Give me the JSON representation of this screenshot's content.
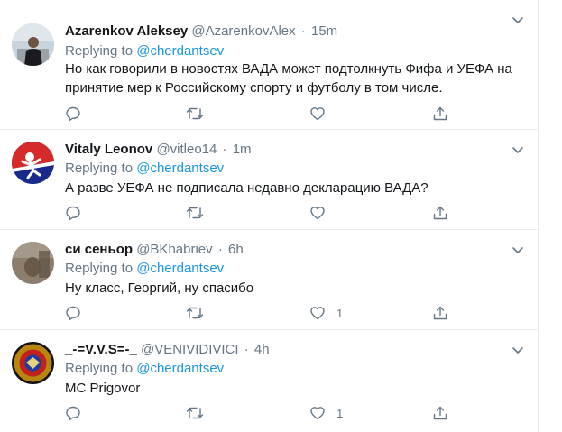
{
  "tweets": [
    {
      "name": "Azarenkov Aleksey",
      "handle": "@AzarenkovAlex",
      "separator": "·",
      "time": "15m",
      "replying_prefix": "Replying to ",
      "replying_to": "@cherdantsev",
      "text_lines": [
        "Но как говорили в новостях ВАДА может подтолкнуть Фифа и УЕФА на",
        "принятие мер к Российскому спорту и футболу в том числе."
      ],
      "like_count": ""
    },
    {
      "name": "Vitaly Leonov",
      "handle": "@vitleo14",
      "separator": "·",
      "time": "1m",
      "replying_prefix": "Replying to ",
      "replying_to": "@cherdantsev",
      "text_lines": [
        "А разве УЕФА не подписала недавно декларацию ВАДА?"
      ],
      "like_count": ""
    },
    {
      "name": "си сеньор",
      "handle": "@BKhabriev",
      "separator": "·",
      "time": "6h",
      "replying_prefix": "Replying to ",
      "replying_to": "@cherdantsev",
      "text_lines": [
        "Ну класс, Георгий, ну спасибо"
      ],
      "like_count": "1"
    },
    {
      "name": "_-=V.V.S=-_",
      "handle": "@VENIVIDIVICI",
      "separator": "·",
      "time": "4h",
      "replying_prefix": "Replying to ",
      "replying_to": "@cherdantsev",
      "text_lines": [
        "MC Prigovor"
      ],
      "like_count": "1"
    }
  ],
  "icons": {
    "reply": "reply-icon",
    "retweet": "retweet-icon",
    "like": "heart-icon",
    "share": "share-icon",
    "more": "chevron-down-icon"
  },
  "colors": {
    "text": "#14171a",
    "secondary": "#657786",
    "link": "#1b95e0",
    "border": "#e6ecf0"
  }
}
